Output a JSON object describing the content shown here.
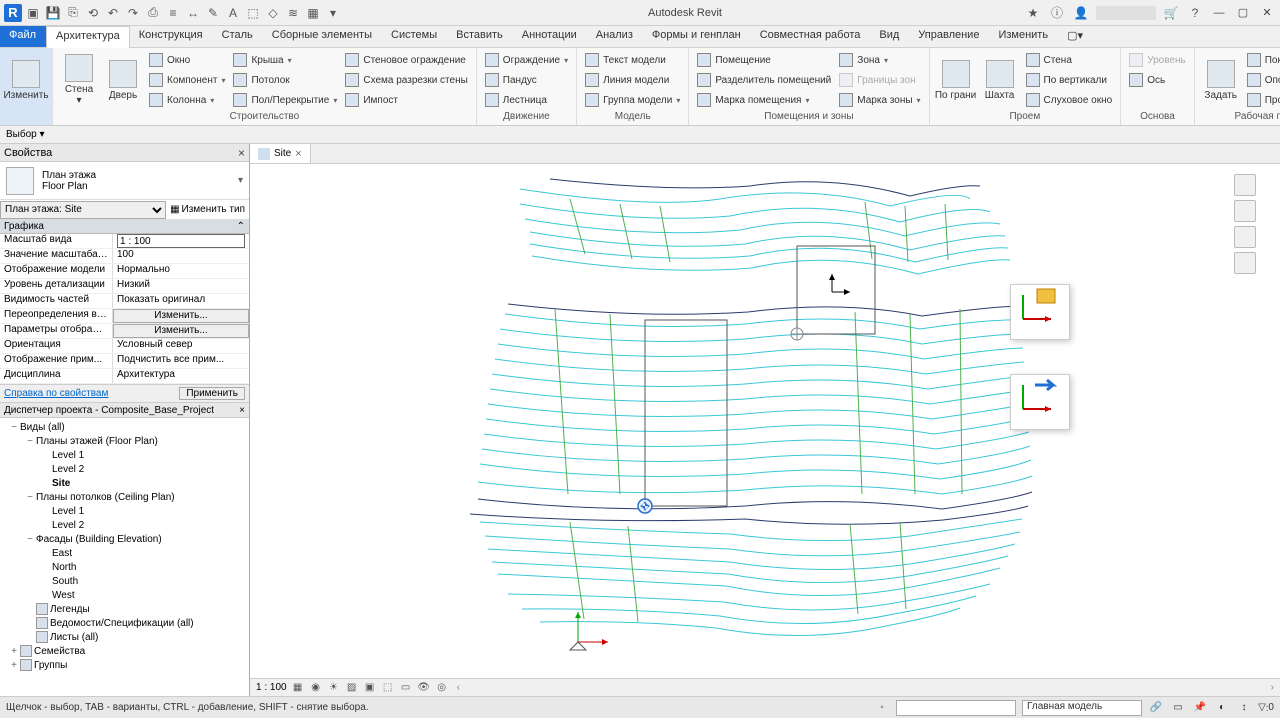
{
  "title": "Autodesk Revit",
  "ribbonTabs": [
    "Файл",
    "Архитектура",
    "Конструкция",
    "Сталь",
    "Сборные элементы",
    "Системы",
    "Вставить",
    "Аннотации",
    "Анализ",
    "Формы и генплан",
    "Совместная работа",
    "Вид",
    "Управление",
    "Изменить"
  ],
  "activeTab": 1,
  "subbar": {
    "sel": "Выбор",
    "drop": "▾"
  },
  "ribbon": {
    "g0": {
      "modify": "Изменить"
    },
    "g1": {
      "wall": "Стена",
      "door": "Дверь",
      "window": "Окно",
      "component": "Компонент",
      "column": "Колонна",
      "roof": "Крыша",
      "ceiling": "Потолок",
      "floor": "Пол/Перекрытие",
      "curtain": "Стеновое ограждение",
      "grid": "Схема разрезки стены",
      "impost": "Импост",
      "label": "Строительство"
    },
    "g2": {
      "rail": "Ограждение",
      "ramp": "Пандус",
      "stair": "Лестница",
      "label": "Движение"
    },
    "g3": {
      "mtext": "Текст модели",
      "mline": "Линия модели",
      "mgroup": "Группа модели",
      "label": "Модель"
    },
    "g4": {
      "room": "Помещение",
      "sep": "Разделитель помещений",
      "tag": "Марка помещения",
      "zone": "Зона",
      "zbound": "Границы зон",
      "ztag": "Марка зоны",
      "label": "Помещения и зоны"
    },
    "g5": {
      "face": "По грани",
      "shaft": "Шахта",
      "wallopen": "Стена",
      "vert": "По вертикали",
      "dormer": "Слуховое окно",
      "label": "Проем"
    },
    "g6": {
      "level": "Уровень",
      "axis": "Ось",
      "label": "Основа"
    },
    "g7": {
      "set": "Задать",
      "show": "Показать",
      "ref": "Опорная плоскость",
      "viewer": "Просмотр",
      "label": "Рабочая плоскость"
    }
  },
  "props": {
    "title": "Свойства",
    "type1": "План этажа",
    "type2": "Floor Plan",
    "combo": "План этажа: Site",
    "edit": "Изменить тип",
    "cat": "Графика",
    "rows": [
      {
        "k": "Масштаб вида",
        "v": "1 : 100",
        "editable": true
      },
      {
        "k": "Значение масштаба ...",
        "v": "100"
      },
      {
        "k": "Отображение модели",
        "v": "Нормально"
      },
      {
        "k": "Уровень детализации",
        "v": "Низкий"
      },
      {
        "k": "Видимость частей",
        "v": "Показать оригинал"
      },
      {
        "k": "Переопределения ви...",
        "v": "Изменить...",
        "btn": true
      },
      {
        "k": "Параметры отображе...",
        "v": "Изменить...",
        "btn": true
      },
      {
        "k": "Ориентация",
        "v": "Условный север"
      },
      {
        "k": "Отображение прим...",
        "v": "Подчистить все прим..."
      },
      {
        "k": "Дисциплина",
        "v": "Архитектура"
      }
    ],
    "help": "Справка по свойствам",
    "apply": "Применить"
  },
  "browser": {
    "title": "Диспетчер проекта - Composite_Base_Project",
    "nodes": [
      {
        "d": 0,
        "tw": "−",
        "lbl": "Виды (all)"
      },
      {
        "d": 1,
        "tw": "−",
        "lbl": "Планы этажей (Floor Plan)"
      },
      {
        "d": 2,
        "tw": "",
        "lbl": "Level 1"
      },
      {
        "d": 2,
        "tw": "",
        "lbl": "Level 2"
      },
      {
        "d": 2,
        "tw": "",
        "lbl": "Site",
        "bold": true
      },
      {
        "d": 1,
        "tw": "−",
        "lbl": "Планы потолков (Ceiling Plan)"
      },
      {
        "d": 2,
        "tw": "",
        "lbl": "Level 1"
      },
      {
        "d": 2,
        "tw": "",
        "lbl": "Level 2"
      },
      {
        "d": 1,
        "tw": "−",
        "lbl": "Фасады (Building Elevation)"
      },
      {
        "d": 2,
        "tw": "",
        "lbl": "East"
      },
      {
        "d": 2,
        "tw": "",
        "lbl": "North"
      },
      {
        "d": 2,
        "tw": "",
        "lbl": "South"
      },
      {
        "d": 2,
        "tw": "",
        "lbl": "West"
      },
      {
        "d": 1,
        "tw": "",
        "lbl": "Легенды",
        "ico": true
      },
      {
        "d": 1,
        "tw": "",
        "lbl": "Ведомости/Спецификации (all)",
        "ico": true
      },
      {
        "d": 1,
        "tw": "",
        "lbl": "Листы (all)",
        "ico": true
      },
      {
        "d": 0,
        "tw": "+",
        "lbl": "Семейства",
        "ico": true
      },
      {
        "d": 0,
        "tw": "+",
        "lbl": "Группы",
        "ico": true
      }
    ]
  },
  "docTab": "Site",
  "viewbar": {
    "scale": "1 : 100"
  },
  "status": {
    "hint": "Щелчок - выбор, TAB - варианты, CTRL - добавление, SHIFT - снятие выбора.",
    "model": "Главная модель",
    "filter": "0"
  }
}
